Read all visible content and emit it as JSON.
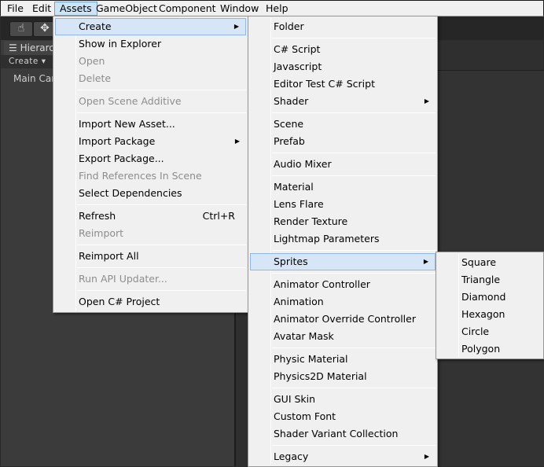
{
  "menubar": {
    "items": [
      {
        "label": "File"
      },
      {
        "label": "Edit"
      },
      {
        "label": "Assets"
      },
      {
        "label": "GameObject"
      },
      {
        "label": "Component"
      },
      {
        "label": "Window"
      },
      {
        "label": "Help"
      }
    ]
  },
  "toolbar": {
    "hand_icon": "☝",
    "move_icon": "✥"
  },
  "hierarchy": {
    "tab_label": "☰ Hierarchy",
    "create_label": "Create ▾",
    "items": [
      "Main Camera"
    ]
  },
  "assets_menu": {
    "items": [
      {
        "label": "Create",
        "submenu": true,
        "highlighted": true
      },
      {
        "label": "Show in Explorer"
      },
      {
        "label": "Open",
        "disabled": true
      },
      {
        "label": "Delete",
        "disabled": true
      },
      {
        "label": "Open Scene Additive",
        "disabled": true
      },
      {
        "label": "Import New Asset..."
      },
      {
        "label": "Import Package",
        "submenu": true
      },
      {
        "label": "Export Package..."
      },
      {
        "label": "Find References In Scene",
        "disabled": true
      },
      {
        "label": "Select Dependencies"
      },
      {
        "label": "Refresh",
        "shortcut": "Ctrl+R"
      },
      {
        "label": "Reimport",
        "disabled": true
      },
      {
        "label": "Reimport All"
      },
      {
        "label": "Run API Updater...",
        "disabled": true
      },
      {
        "label": "Open C# Project"
      }
    ]
  },
  "create_menu": {
    "items": [
      {
        "label": "Folder"
      },
      {
        "label": "C# Script"
      },
      {
        "label": "Javascript"
      },
      {
        "label": "Editor Test C# Script"
      },
      {
        "label": "Shader",
        "submenu": true
      },
      {
        "label": "Scene"
      },
      {
        "label": "Prefab"
      },
      {
        "label": "Audio Mixer"
      },
      {
        "label": "Material"
      },
      {
        "label": "Lens Flare"
      },
      {
        "label": "Render Texture"
      },
      {
        "label": "Lightmap Parameters"
      },
      {
        "label": "Sprites",
        "submenu": true,
        "highlighted": true
      },
      {
        "label": "Animator Controller"
      },
      {
        "label": "Animation"
      },
      {
        "label": "Animator Override Controller"
      },
      {
        "label": "Avatar Mask"
      },
      {
        "label": "Physic Material"
      },
      {
        "label": "Physics2D Material"
      },
      {
        "label": "GUI Skin"
      },
      {
        "label": "Custom Font"
      },
      {
        "label": "Shader Variant Collection"
      },
      {
        "label": "Legacy",
        "submenu": true
      }
    ]
  },
  "sprites_menu": {
    "items": [
      {
        "label": "Square"
      },
      {
        "label": "Triangle"
      },
      {
        "label": "Diamond"
      },
      {
        "label": "Hexagon"
      },
      {
        "label": "Circle"
      },
      {
        "label": "Polygon"
      }
    ]
  },
  "colors": {
    "menu_bg": "#f0f0f0",
    "highlight_bg": "#d6e6f7",
    "highlight_border": "#8fb8e8",
    "disabled_text": "#8d8d8d",
    "editor_bg": "#2f2f2f"
  }
}
